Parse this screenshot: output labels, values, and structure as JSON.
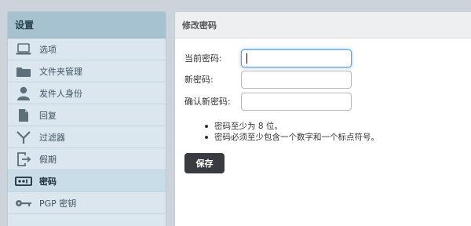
{
  "sidebar": {
    "title": "设置",
    "items": [
      {
        "label": "选项",
        "icon": "laptop-icon",
        "selected": false
      },
      {
        "label": "文件夹管理",
        "icon": "folder-icon",
        "selected": false
      },
      {
        "label": "发件人身份",
        "icon": "user-icon",
        "selected": false
      },
      {
        "label": "回复",
        "icon": "document-icon",
        "selected": false
      },
      {
        "label": "过滤器",
        "icon": "filter-icon",
        "selected": false
      },
      {
        "label": "假期",
        "icon": "exit-icon",
        "selected": false
      },
      {
        "label": "密码",
        "icon": "password-icon",
        "selected": true
      },
      {
        "label": "PGP 密钥",
        "icon": "key-icon",
        "selected": false
      }
    ]
  },
  "main": {
    "title": "修改密码",
    "fields": {
      "current_label": "当前密码:",
      "current_value": "",
      "new_label": "新密码:",
      "new_value": "",
      "confirm_label": "确认新密码:",
      "confirm_value": ""
    },
    "rules": [
      "密码至少为 8 位。",
      "密码必须至少包含一个数字和一个标点符号。"
    ],
    "save_label": "保存"
  },
  "colors": {
    "sidebar_header": "#a6c1cf",
    "sidebar_bg": "#dbe6ee",
    "selected_bg": "#c8dde8",
    "button_bg": "#383c40",
    "focus_border": "#5e9ed6"
  }
}
